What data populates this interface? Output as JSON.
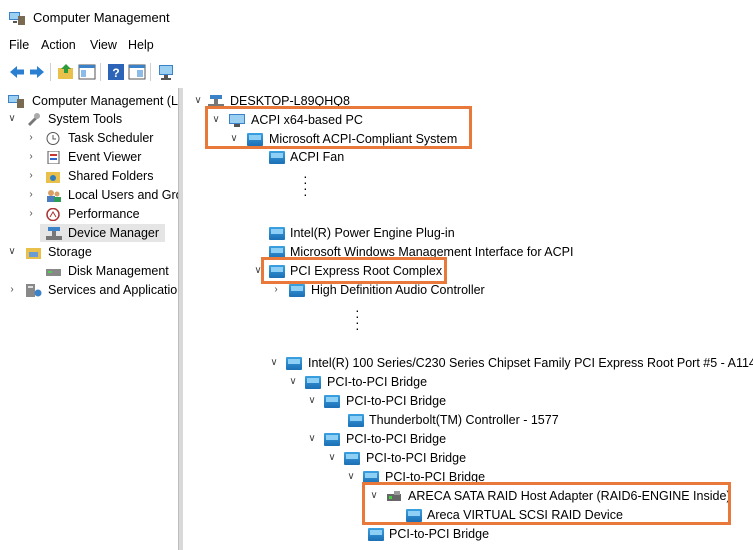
{
  "window": {
    "title": "Computer Management"
  },
  "menu": [
    "File",
    "Action",
    "View",
    "Help"
  ],
  "left_tree": [
    {
      "label": "Computer Management (L",
      "icon": "computer-management-icon"
    },
    {
      "label": "System Tools",
      "icon": "system-tools-icon",
      "expanded": true
    },
    {
      "label": "Task Scheduler",
      "icon": "clock-icon"
    },
    {
      "label": "Event Viewer",
      "icon": "event-viewer-icon"
    },
    {
      "label": "Shared Folders",
      "icon": "shared-folder-icon"
    },
    {
      "label": "Local Users and Gro",
      "icon": "users-icon"
    },
    {
      "label": "Performance",
      "icon": "performance-icon"
    },
    {
      "label": "Device Manager",
      "icon": "device-manager-icon",
      "selected": true
    },
    {
      "label": "Storage",
      "icon": "storage-icon",
      "expanded": true
    },
    {
      "label": "Disk Management",
      "icon": "disk-icon"
    },
    {
      "label": "Services and Applicatio",
      "icon": "services-icon"
    }
  ],
  "device_tree": [
    {
      "label": "DESKTOP-L89QHQ8",
      "icon": "computer-icon"
    },
    {
      "label": "ACPI x64-based PC",
      "icon": "monitor-icon"
    },
    {
      "label": "Microsoft ACPI-Compliant System",
      "icon": "pci-device-icon"
    },
    {
      "label": "ACPI Fan",
      "icon": "pci-device-icon"
    },
    {
      "label": "Intel(R) Power Engine Plug-in",
      "icon": "pci-device-icon"
    },
    {
      "label": "Microsoft Windows Management Interface for ACPI",
      "icon": "pci-device-icon"
    },
    {
      "label": "PCI Express Root Complex",
      "icon": "pci-device-icon"
    },
    {
      "label": "High Definition Audio Controller",
      "icon": "pci-device-icon"
    },
    {
      "label": "Intel(R) 100 Series/C230 Series Chipset Family PCI Express Root Port #5 - A114",
      "icon": "pci-device-icon"
    },
    {
      "label": "PCI-to-PCI Bridge",
      "icon": "pci-device-icon"
    },
    {
      "label": "PCI-to-PCI Bridge",
      "icon": "pci-device-icon"
    },
    {
      "label": "Thunderbolt(TM) Controller - 1577",
      "icon": "pci-device-icon"
    },
    {
      "label": "PCI-to-PCI Bridge",
      "icon": "pci-device-icon"
    },
    {
      "label": "PCI-to-PCI Bridge",
      "icon": "pci-device-icon"
    },
    {
      "label": "PCI-to-PCI Bridge",
      "icon": "pci-device-icon"
    },
    {
      "label": "ARECA SATA RAID Host Adapter (RAID6-ENGINE Inside)",
      "icon": "raid-adapter-icon"
    },
    {
      "label": "Areca VIRTUAL SCSI RAID Device",
      "icon": "pci-device-icon"
    },
    {
      "label": "PCI-to-PCI Bridge",
      "icon": "pci-device-icon"
    }
  ],
  "colors": {
    "highlight_box": "#e8793a",
    "selection": "#e5e5e5",
    "device_icon": "#1c6fb4"
  }
}
